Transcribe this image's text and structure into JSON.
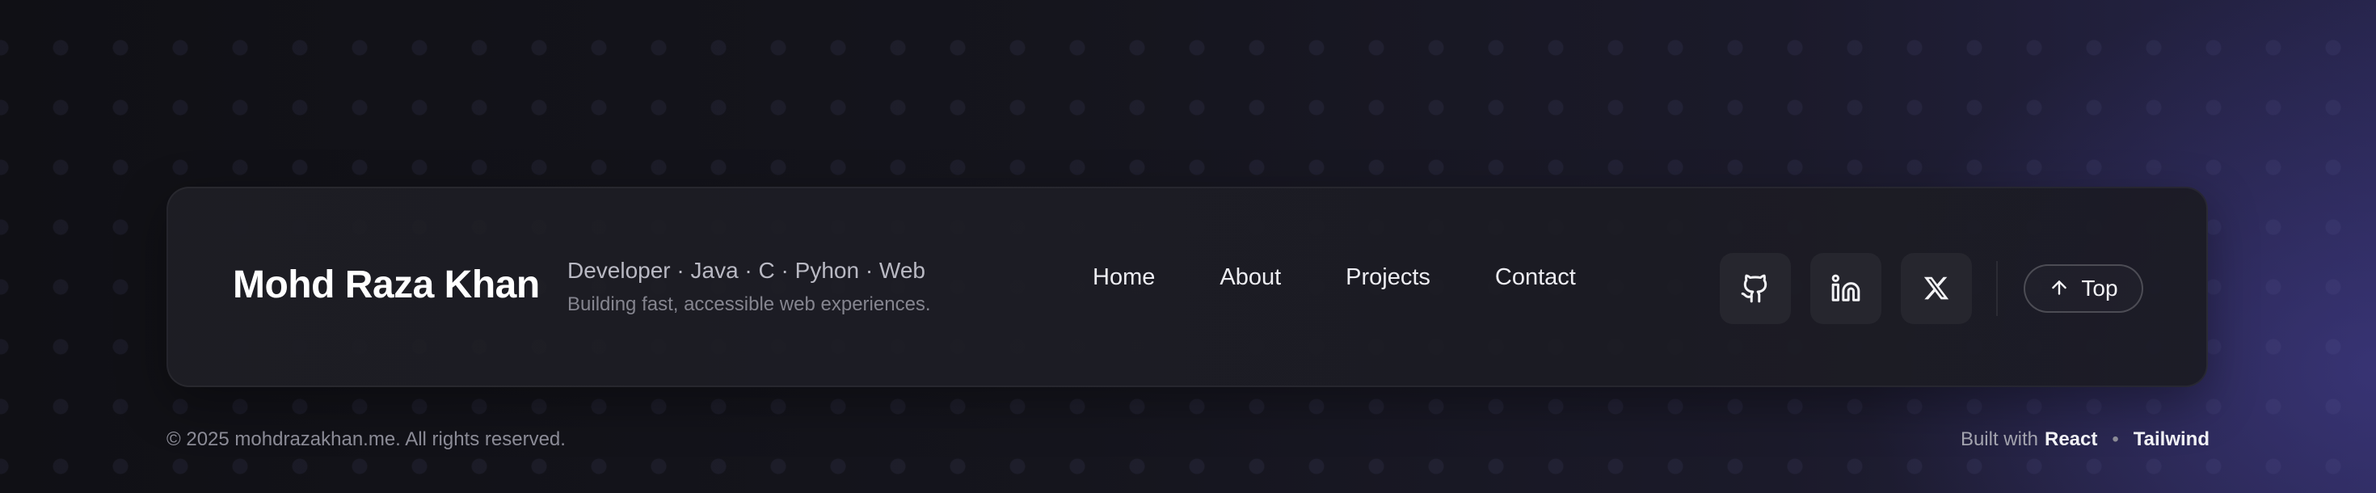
{
  "brand": {
    "name": "Mohd Raza Khan",
    "tagline_primary": "Developer · Java · C · Pyhon · Web",
    "tagline_secondary": "Building fast, accessible web experiences."
  },
  "nav": {
    "items": [
      {
        "label": "Home"
      },
      {
        "label": "About"
      },
      {
        "label": "Projects"
      },
      {
        "label": "Contact"
      }
    ]
  },
  "social": {
    "items": [
      {
        "icon": "github-icon"
      },
      {
        "icon": "linkedin-icon"
      },
      {
        "icon": "x-icon"
      }
    ]
  },
  "top_button": {
    "icon": "arrow-up-icon",
    "label": "Top"
  },
  "bottom": {
    "copyright": "© 2025 mohdrazakhan.me. All rights reserved.",
    "built_with_prefix": "Built with",
    "tech": [
      "React",
      "Tailwind"
    ],
    "separator": "•"
  },
  "colors": {
    "background": "#14141b",
    "card": "#1d1d25",
    "icon_tile": "#26262e",
    "text_primary": "#ffffff",
    "text_muted": "#8b8b96",
    "accent_glow": "#3d3a7a"
  }
}
